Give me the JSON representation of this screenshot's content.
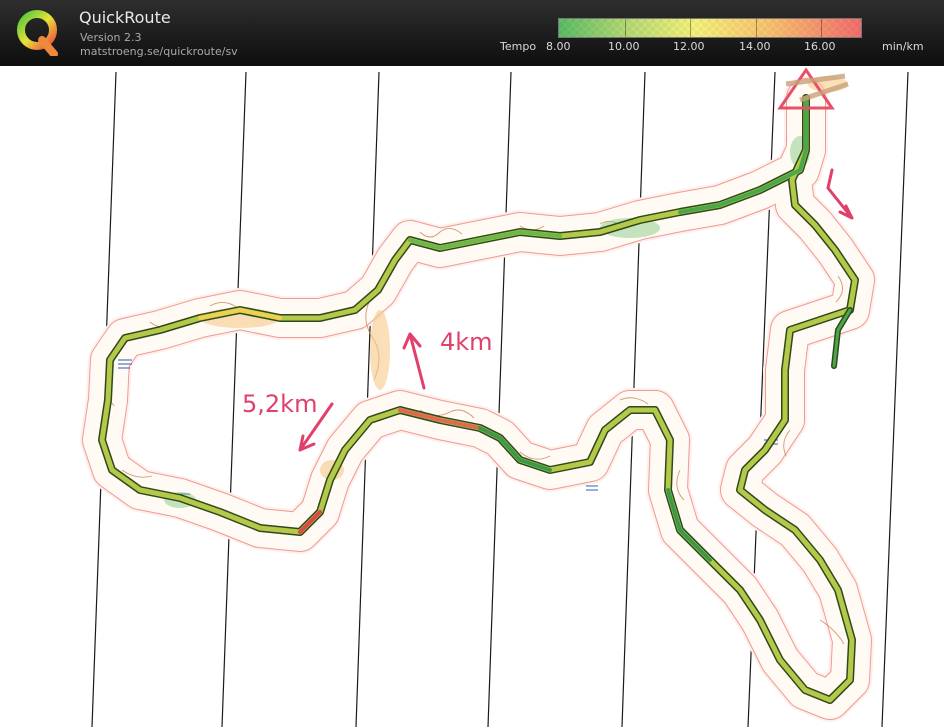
{
  "app": {
    "name": "QuickRoute",
    "version": "Version 2.3",
    "url": "matstroeng.se/quickroute/sv"
  },
  "legend": {
    "label": "Tempo",
    "ticks": [
      "8.00",
      "10.00",
      "12.00",
      "14.00",
      "16.00"
    ],
    "unit": "min/km",
    "colors": [
      "#2eaa3c",
      "#96c83c",
      "#f0eb46",
      "#f5aa3c",
      "#ee4646"
    ]
  },
  "map": {
    "annotations": [
      "4km",
      "5,2km"
    ],
    "annotation_color": "#e0406a",
    "icons": [
      "start-triangle-icon",
      "direction-arrow-icon"
    ]
  }
}
